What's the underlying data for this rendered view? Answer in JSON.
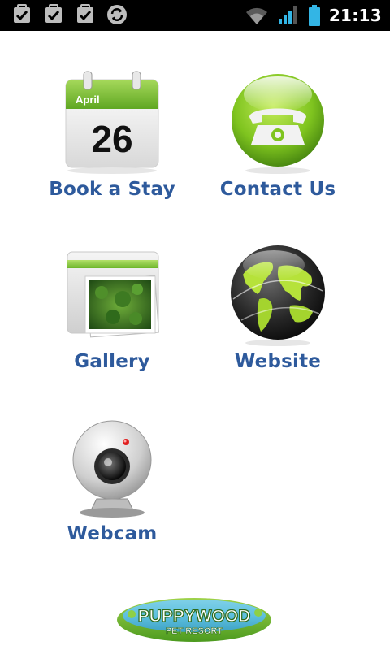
{
  "status_bar": {
    "time": "21:13",
    "left_icons": [
      "checkbox-icon",
      "checkbox-icon",
      "checkbox-icon",
      "sync-icon"
    ],
    "right_icons": [
      "wifi-icon",
      "signal-icon",
      "battery-icon"
    ]
  },
  "calendar_icon": {
    "month": "April",
    "day": "26"
  },
  "tiles": [
    {
      "label": "Book a Stay",
      "icon": "calendar-icon"
    },
    {
      "label": "Contact Us",
      "icon": "phone-icon"
    },
    {
      "label": "Gallery",
      "icon": "gallery-icon"
    },
    {
      "label": "Website",
      "icon": "globe-icon"
    },
    {
      "label": "Webcam",
      "icon": "webcam-icon"
    }
  ],
  "logo": {
    "name": "PUPPYWOOD",
    "tagline": "PET RESORT"
  },
  "colors": {
    "label": "#2e5a9c",
    "accent_green": "#7ac142",
    "status_bar_bg": "#000000"
  }
}
